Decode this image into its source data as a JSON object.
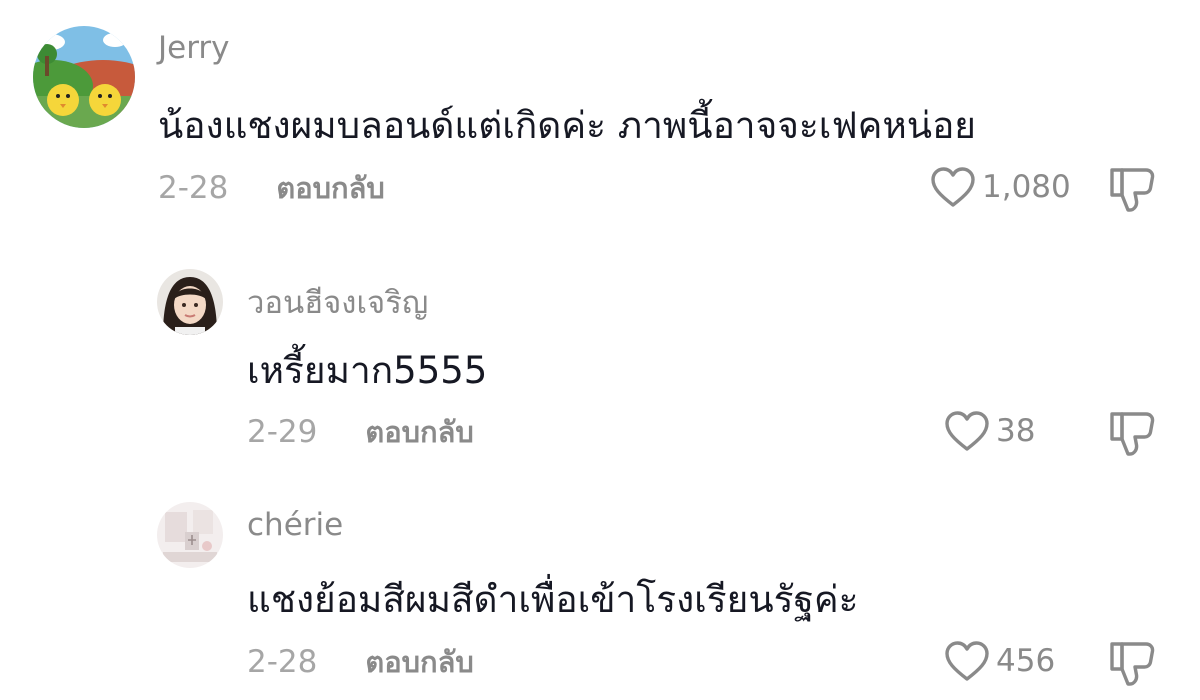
{
  "comments": [
    {
      "username": "Jerry",
      "text": "น้องแชงผมบลอนด์แต่เกิดค่ะ ภาพนี้อาจจะเฟคหน่อย",
      "date": "2-28",
      "reply_label": "ตอบกลับ",
      "likes": "1,080",
      "avatar_icon": "cartoon-chicks-avatar"
    },
    {
      "username": "วอนฮีจงเจริญ",
      "text": "เหรี้ยมาก5555",
      "date": "2-29",
      "reply_label": "ตอบกลับ",
      "likes": "38",
      "avatar_icon": "girl-portrait-avatar"
    },
    {
      "username": "chérie",
      "text": "แชงย้อมสีผมสีดำเพื่อเข้าโรงเรียนรัฐค่ะ",
      "date": "2-28",
      "reply_label": "ตอบกลับ",
      "likes": "456",
      "avatar_icon": "light-room-avatar"
    }
  ],
  "colors": {
    "text_primary": "#161823",
    "text_secondary": "#8a8a8a",
    "icon": "#8a8a8a"
  }
}
